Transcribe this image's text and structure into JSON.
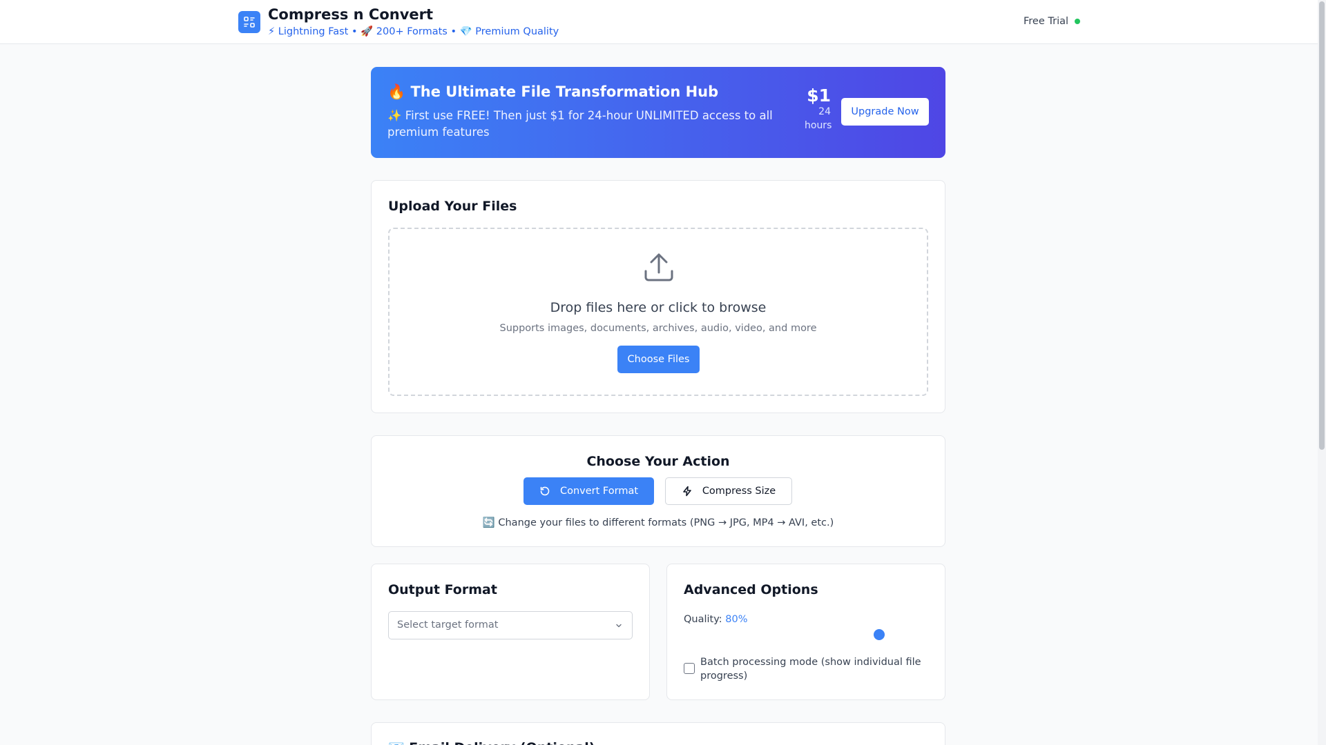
{
  "header": {
    "title": "Compress n Convert",
    "tagline": "⚡ Lightning Fast • 🚀 200+ Formats • 💎 Premium Quality",
    "trial_label": "Free Trial",
    "status_color": "#22c55e"
  },
  "hero": {
    "title": "🔥 The Ultimate File Transformation Hub",
    "subtitle": "✨ First use FREE! Then just $1 for 24-hour UNLIMITED access to all premium features",
    "price": "$1",
    "price_period": "24 hours",
    "upgrade_label": "Upgrade Now"
  },
  "upload": {
    "title": "Upload Your Files",
    "drop_title": "Drop files here or click to browse",
    "drop_subtitle": "Supports images, documents, archives, audio, video, and more",
    "choose_label": "Choose Files"
  },
  "action": {
    "title": "Choose Your Action",
    "convert_label": "Convert Format",
    "compress_label": "Compress Size",
    "selected": "Convert Format",
    "description": "🔄 Change your files to different formats (PNG → JPG, MP4 → AVI, etc.)"
  },
  "output": {
    "title": "Output Format",
    "placeholder": "Select target format"
  },
  "advanced": {
    "title": "Advanced Options",
    "quality_label": "Quality:",
    "quality_value": "80%",
    "quality_fraction": 0.8,
    "batch_label": "Batch processing mode (show individual file progress)",
    "batch_checked": false
  },
  "email": {
    "title": "📧 Email Delivery (Optional)"
  },
  "colors": {
    "accent": "#3b82f6",
    "hero_start": "#3b82f6",
    "hero_end": "#4f46e5"
  }
}
